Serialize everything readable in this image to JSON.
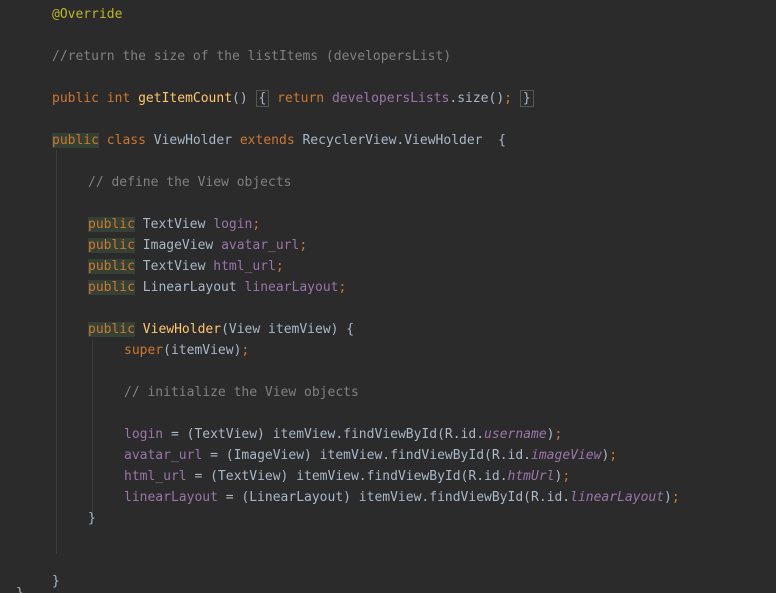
{
  "editor": {
    "colors": {
      "background": "#2b2b2b",
      "keyword": "#cc7832",
      "annotation": "#bbb529",
      "method": "#ffc66d",
      "field": "#9876aa",
      "comment": "#808080",
      "text": "#a9b7c6"
    },
    "lines": [
      {
        "tokens": [
          {
            "t": "@Override",
            "c": "ann"
          }
        ]
      },
      {
        "tokens": []
      },
      {
        "tokens": [
          {
            "t": "//return the size of the listItems (developersList)",
            "c": "comment"
          }
        ]
      },
      {
        "tokens": []
      },
      {
        "tokens": [
          {
            "t": "public ",
            "c": "kw"
          },
          {
            "t": "int ",
            "c": "kw"
          },
          {
            "t": "getItemCount",
            "c": "fn"
          },
          {
            "t": "() ",
            "c": "plain"
          },
          {
            "t": "{",
            "c": "fold"
          },
          {
            "t": " return ",
            "c": "kw"
          },
          {
            "t": "developersLists",
            "c": "field"
          },
          {
            "t": ".size()",
            "c": "plain"
          },
          {
            "t": "; ",
            "c": "kw"
          },
          {
            "t": "}",
            "c": "fold"
          }
        ]
      },
      {
        "tokens": []
      },
      {
        "tokens": [
          {
            "t": "public",
            "c": "kw hl"
          },
          {
            "t": " class ",
            "c": "kw"
          },
          {
            "t": "ViewHolder ",
            "c": "plain"
          },
          {
            "t": "extends ",
            "c": "kw"
          },
          {
            "t": "RecyclerView.ViewHolder  {",
            "c": "plain"
          }
        ]
      },
      {
        "tokens": []
      },
      {
        "tokens": [
          {
            "t": "// define the View objects",
            "c": "comment"
          }
        ]
      },
      {
        "tokens": []
      },
      {
        "tokens": [
          {
            "t": "public",
            "c": "kw hl"
          },
          {
            "t": " TextView ",
            "c": "plain"
          },
          {
            "t": "login",
            "c": "field"
          },
          {
            "t": ";",
            "c": "kw"
          }
        ]
      },
      {
        "tokens": [
          {
            "t": "public",
            "c": "kw hl"
          },
          {
            "t": " ImageView ",
            "c": "plain"
          },
          {
            "t": "avatar_url",
            "c": "field"
          },
          {
            "t": ";",
            "c": "kw"
          }
        ]
      },
      {
        "tokens": [
          {
            "t": "public",
            "c": "kw hl"
          },
          {
            "t": " TextView ",
            "c": "plain"
          },
          {
            "t": "html_url",
            "c": "field"
          },
          {
            "t": ";",
            "c": "kw"
          }
        ]
      },
      {
        "tokens": [
          {
            "t": "public",
            "c": "kw hl"
          },
          {
            "t": " LinearLayout ",
            "c": "plain"
          },
          {
            "t": "linearLayout",
            "c": "field"
          },
          {
            "t": ";",
            "c": "kw"
          }
        ]
      },
      {
        "tokens": []
      },
      {
        "tokens": [
          {
            "t": "public",
            "c": "kw hl"
          },
          {
            "t": " ",
            "c": "plain"
          },
          {
            "t": "ViewHolder",
            "c": "fn"
          },
          {
            "t": "(View itemView) {",
            "c": "plain"
          }
        ]
      },
      {
        "tokens": [
          {
            "t": "super",
            "c": "kw"
          },
          {
            "t": "(itemView)",
            "c": "plain"
          },
          {
            "t": ";",
            "c": "kw"
          }
        ]
      },
      {
        "tokens": []
      },
      {
        "tokens": [
          {
            "t": "// initialize the View objects",
            "c": "comment"
          }
        ]
      },
      {
        "tokens": []
      },
      {
        "tokens": [
          {
            "t": "login",
            "c": "field"
          },
          {
            "t": " = (TextView) itemView.findViewById(R.id.",
            "c": "plain"
          },
          {
            "t": "username",
            "c": "field italic"
          },
          {
            "t": ")",
            "c": "plain"
          },
          {
            "t": ";",
            "c": "kw"
          }
        ]
      },
      {
        "tokens": [
          {
            "t": "avatar_url",
            "c": "field"
          },
          {
            "t": " = (ImageView) itemView.findViewById(R.id.",
            "c": "plain"
          },
          {
            "t": "imageView",
            "c": "field italic"
          },
          {
            "t": ")",
            "c": "plain"
          },
          {
            "t": ";",
            "c": "kw"
          }
        ]
      },
      {
        "tokens": [
          {
            "t": "html_url",
            "c": "field"
          },
          {
            "t": " = (TextView) itemView.findViewById(R.id.",
            "c": "plain"
          },
          {
            "t": "htmUrl",
            "c": "field italic"
          },
          {
            "t": ")",
            "c": "plain"
          },
          {
            "t": ";",
            "c": "kw"
          }
        ]
      },
      {
        "tokens": [
          {
            "t": "linearLayout",
            "c": "field"
          },
          {
            "t": " = (LinearLayout) itemView.findViewById(R.id.",
            "c": "plain"
          },
          {
            "t": "linearLayout",
            "c": "field italic"
          },
          {
            "t": ")",
            "c": "plain"
          },
          {
            "t": ";",
            "c": "kw"
          }
        ]
      },
      {
        "tokens": [
          {
            "t": "}",
            "c": "plain"
          }
        ]
      },
      {
        "tokens": []
      },
      {
        "tokens": []
      },
      {
        "tokens": [
          {
            "t": "}",
            "c": "plain"
          }
        ]
      },
      {
        "tokens": [
          {
            "t": "}",
            "c": "plain"
          }
        ]
      }
    ]
  }
}
